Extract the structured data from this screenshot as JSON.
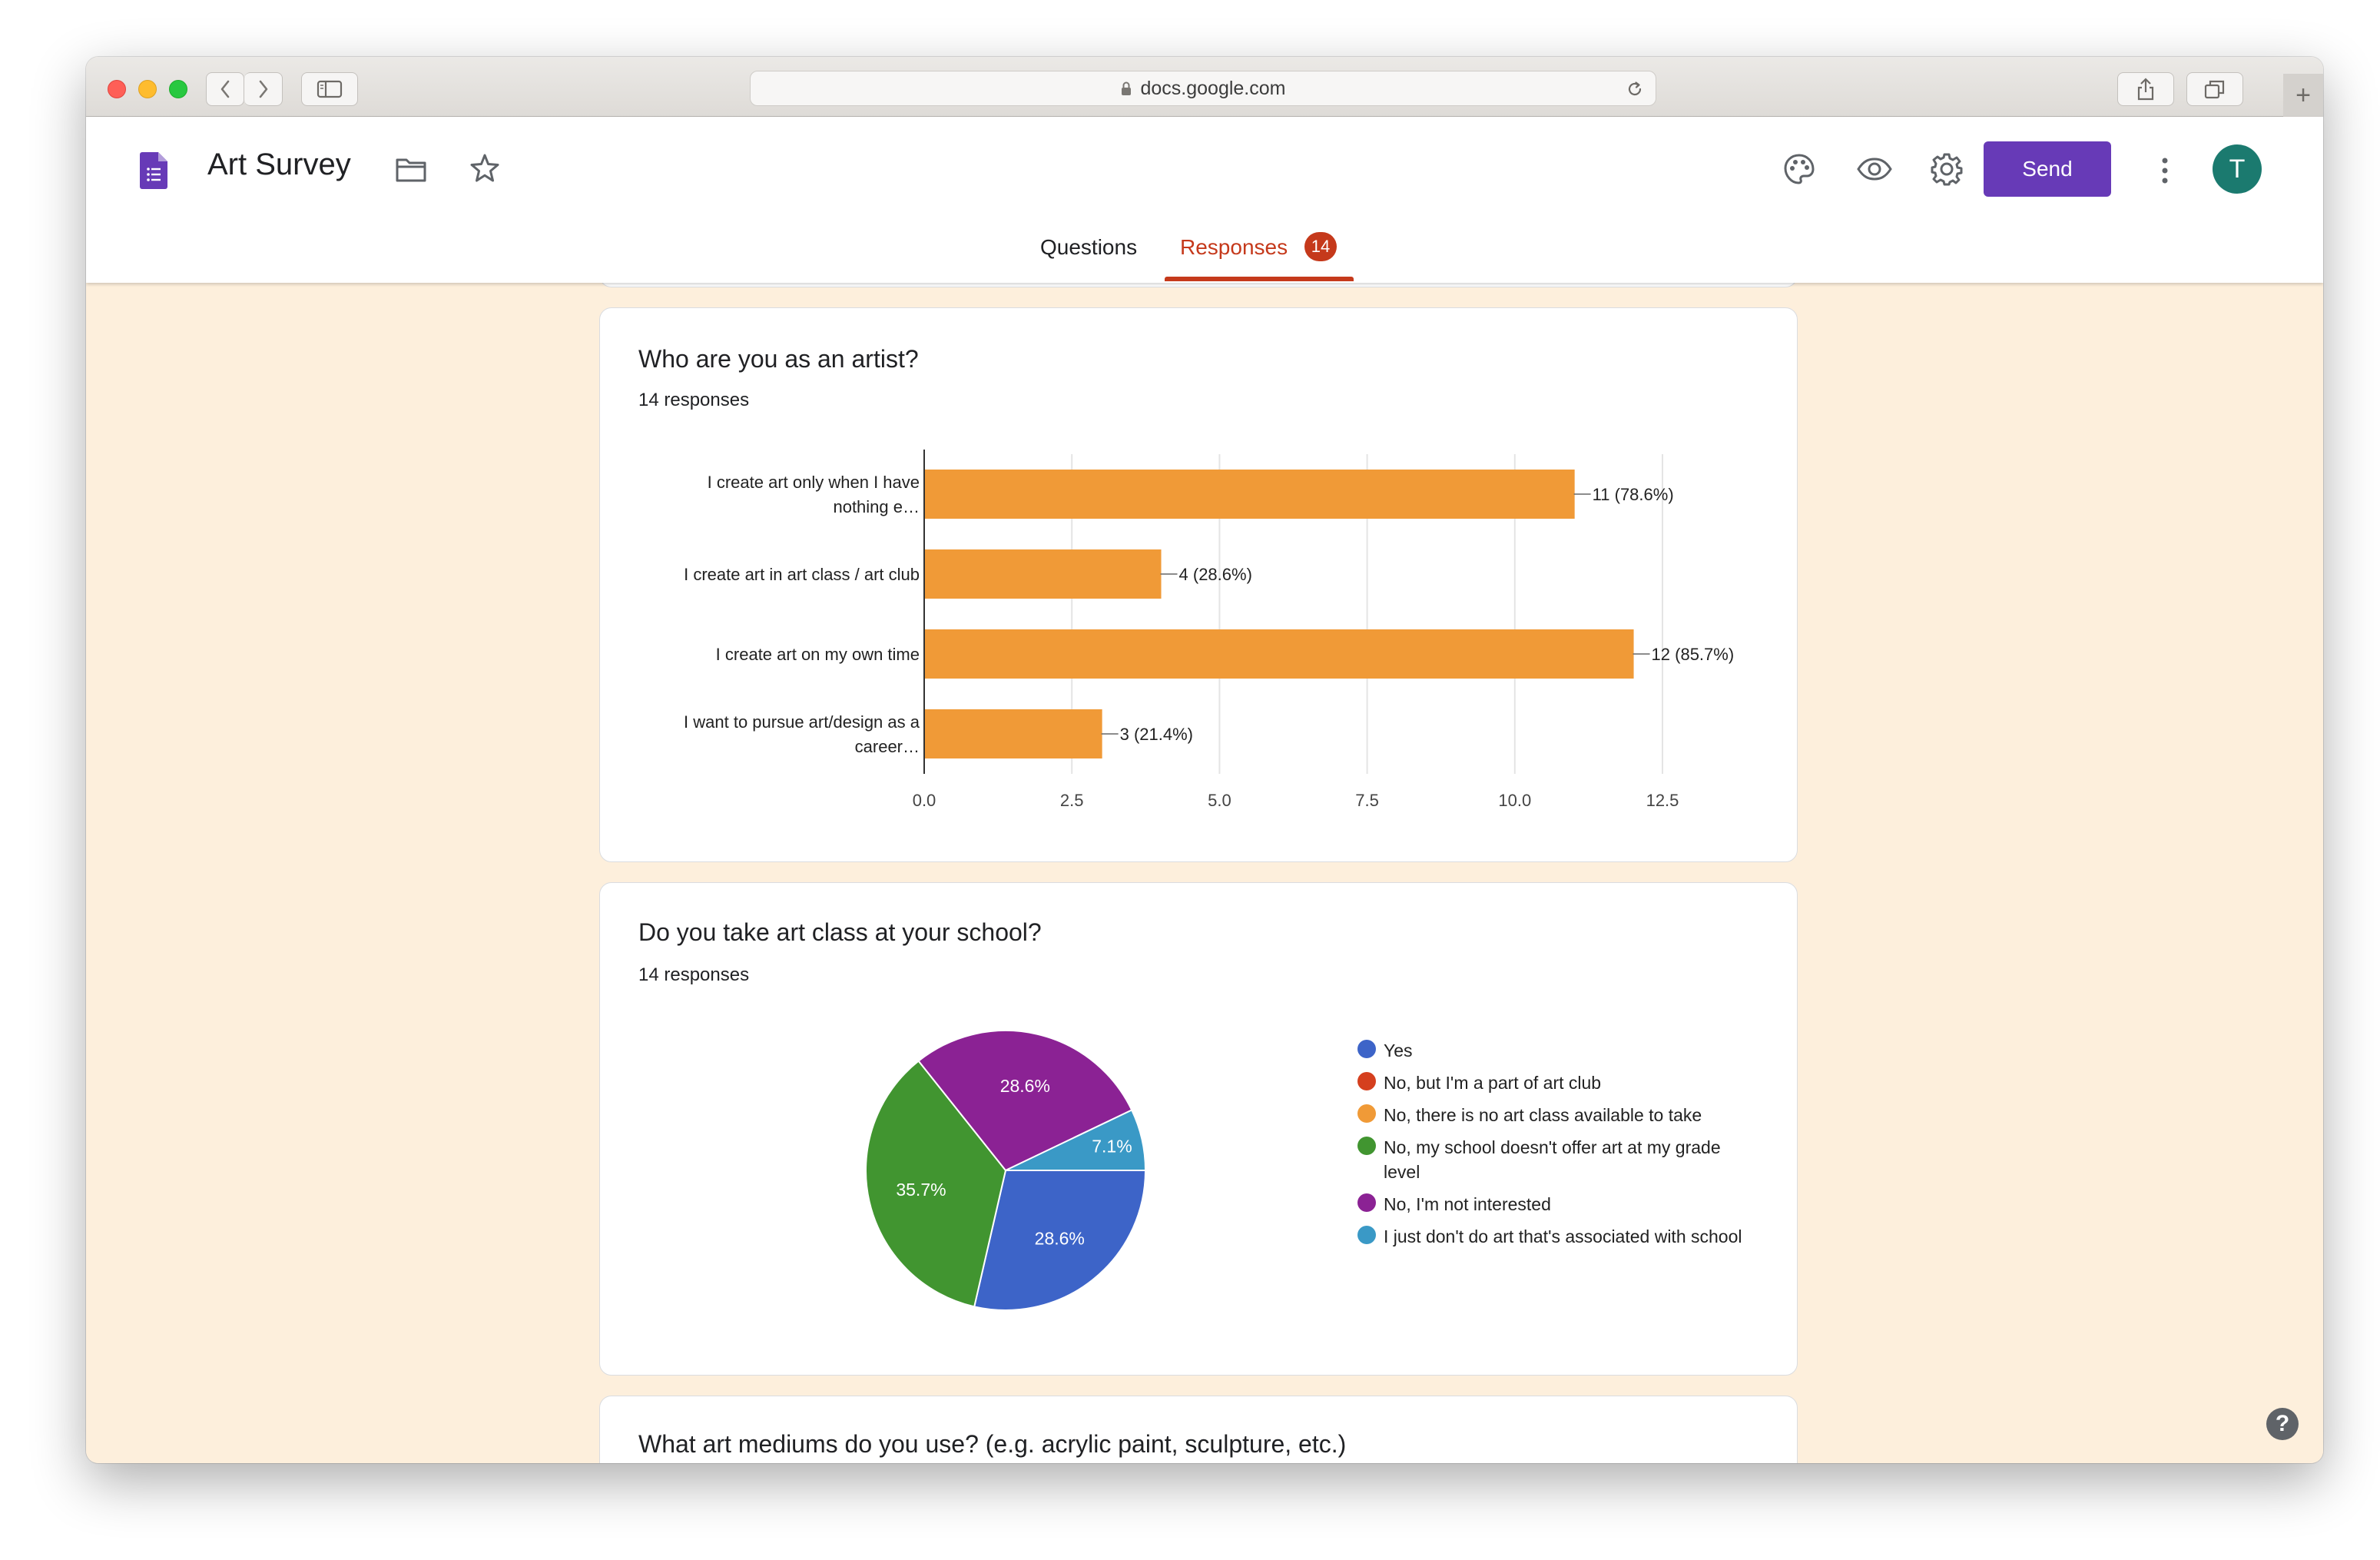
{
  "browser": {
    "url": "docs.google.com"
  },
  "header": {
    "title": "Art Survey",
    "send_label": "Send",
    "avatar_initial": "T",
    "tabs": [
      {
        "label": "Questions"
      },
      {
        "label": "Responses"
      }
    ],
    "responses_badge": "14",
    "accent": "#673ab7",
    "active_tab_color": "#c5391b"
  },
  "questions": [
    {
      "title": "Who are you as an artist?",
      "subtitle": "14 responses",
      "chart_data": {
        "type": "bar",
        "orientation": "horizontal",
        "categories": [
          [
            "I create art only when I have",
            "nothing e…"
          ],
          [
            "I create art in art class / art club"
          ],
          [
            "I create art on my own time"
          ],
          [
            "I want to pursue art/design as a",
            "career…"
          ]
        ],
        "values": [
          11,
          4,
          12,
          3
        ],
        "value_labels": [
          "11 (78.6%)",
          "4 (28.6%)",
          "12 (85.7%)",
          "3 (21.4%)"
        ],
        "xticks": [
          "0.0",
          "2.5",
          "5.0",
          "7.5",
          "10.0",
          "12.5"
        ],
        "xlim": [
          0,
          12.5
        ],
        "color": "#f09a37",
        "grid": true
      }
    },
    {
      "title": "Do you take art class at your school?",
      "subtitle": "14 responses",
      "chart_data": {
        "type": "pie",
        "slices": [
          {
            "label": "Yes",
            "value": 28.6,
            "display": "28.6%",
            "color": "#3d64c8"
          },
          {
            "label": "No, but I'm a part of art club",
            "value": 0,
            "display": "",
            "color": "#d53f1e"
          },
          {
            "label": "No, there is no art class available to take",
            "value": 0,
            "display": "",
            "color": "#f09a37"
          },
          {
            "label": "No, my school doesn't offer art at my grade level",
            "value": 35.7,
            "display": "35.7%",
            "color": "#419530"
          },
          {
            "label": "No, I'm not interested",
            "value": 28.6,
            "display": "28.6%",
            "color": "#8b2294"
          },
          {
            "label": "I just don't do art that's associated with school",
            "value": 7.1,
            "display": "7.1%",
            "color": "#3a99c6"
          }
        ],
        "legend_position": "right"
      }
    },
    {
      "title": "What art mediums do you use? (e.g. acrylic paint, sculpture, etc.)"
    }
  ],
  "help_label": "?"
}
